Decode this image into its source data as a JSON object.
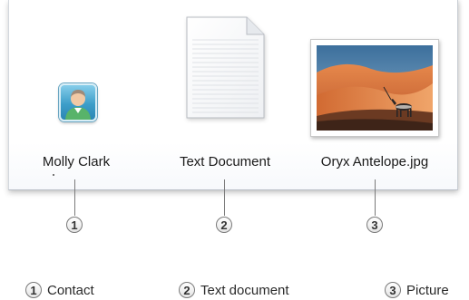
{
  "files": [
    {
      "name": "Molly Clark",
      "icon": "contact-icon",
      "callout": "1"
    },
    {
      "name": "Text Document",
      "icon": "text-document-icon",
      "callout": "2"
    },
    {
      "name": "Oryx Antelope.jpg",
      "icon": "picture-thumbnail",
      "callout": "3"
    }
  ],
  "legend": [
    {
      "number": "1",
      "label": "Contact"
    },
    {
      "number": "2",
      "label": "Text document"
    },
    {
      "number": "3",
      "label": "Picture"
    }
  ],
  "colors": {
    "contact_tile": "#3d9ec9",
    "callout_line": "#7a7a7a",
    "desert_sand": "#d9703a"
  }
}
